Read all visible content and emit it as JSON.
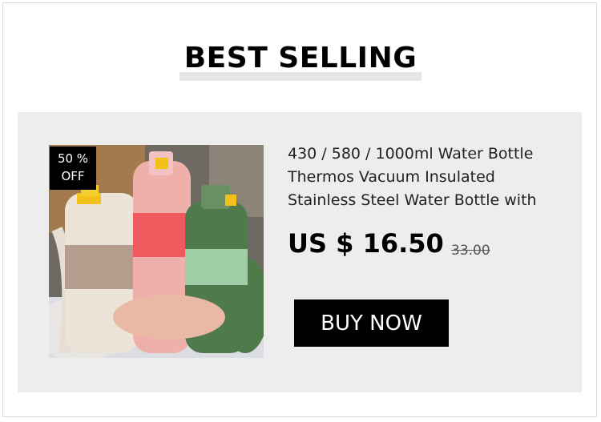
{
  "section": {
    "heading": "BEST SELLING"
  },
  "product": {
    "image_icon": "water-bottles-photo",
    "discount_badge": {
      "line1": "50 %",
      "line2": "OFF"
    },
    "title_lines": [
      "430 / 580 / 1000ml Water Bottle",
      "Thermos Vacuum Insulated",
      "Stainless Steel Water Bottle with"
    ],
    "price": "US $ 16.50",
    "original_price": "33.00",
    "buy_label": "BUY NOW"
  },
  "colors": {
    "card_background": "#ededed",
    "button": "#000000",
    "badge": "#000000"
  }
}
